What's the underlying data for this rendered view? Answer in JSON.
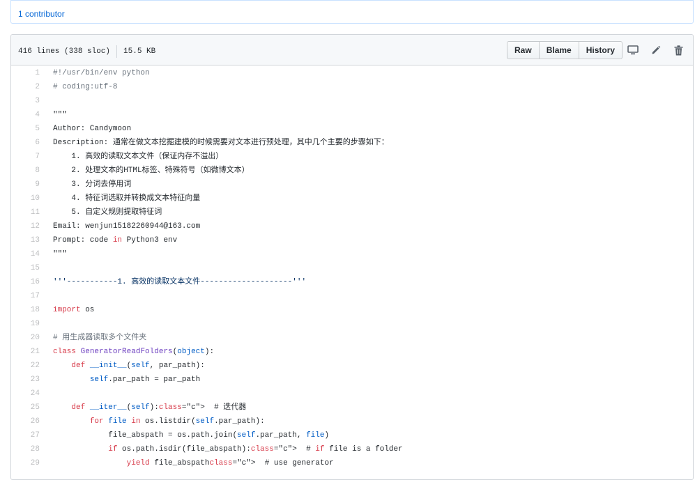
{
  "contributors": {
    "label": "1 contributor"
  },
  "file": {
    "lines": "416 lines (338 sloc)",
    "size": "15.5 KB"
  },
  "buttons": {
    "raw": "Raw",
    "blame": "Blame",
    "history": "History"
  },
  "icons": {
    "desktop": "desktop-icon",
    "edit": "pencil-icon",
    "delete": "trash-icon"
  },
  "code": [
    {
      "n": "1",
      "t": "#!/usr/bin/env python"
    },
    {
      "n": "2",
      "t": "# coding:utf-8"
    },
    {
      "n": "3",
      "t": ""
    },
    {
      "n": "4",
      "t": "\"\"\""
    },
    {
      "n": "5",
      "t": "Author: Candymoon"
    },
    {
      "n": "6",
      "t": "Description: 通常在做文本挖掘建模的时候需要对文本进行预处理，其中几个主要的步骤如下："
    },
    {
      "n": "7",
      "t": "    1. 高效的读取文本文件（保证内存不溢出）"
    },
    {
      "n": "8",
      "t": "    2. 处理文本的HTML标签、特殊符号（如微博文本）"
    },
    {
      "n": "9",
      "t": "    3. 分词去停用词"
    },
    {
      "n": "10",
      "t": "    4. 特征词选取并转换成文本特征向量"
    },
    {
      "n": "11",
      "t": "    5. 自定义规则提取特征词"
    },
    {
      "n": "12",
      "t": "Email: wenjun15182260944@163.com"
    },
    {
      "n": "13",
      "t": "Prompt: code in Python3 env"
    },
    {
      "n": "14",
      "t": "\"\"\""
    },
    {
      "n": "15",
      "t": ""
    },
    {
      "n": "16",
      "t": "'''-----------1. 高效的读取文本文件--------------------'''"
    },
    {
      "n": "17",
      "t": ""
    },
    {
      "n": "18",
      "t": "import os"
    },
    {
      "n": "19",
      "t": ""
    },
    {
      "n": "20",
      "t": "# 用生成器读取多个文件夹"
    },
    {
      "n": "21",
      "t": "class GeneratorReadFolders(object):"
    },
    {
      "n": "22",
      "t": "    def __init__(self, par_path):"
    },
    {
      "n": "23",
      "t": "        self.par_path = par_path"
    },
    {
      "n": "24",
      "t": ""
    },
    {
      "n": "25",
      "t": "    def __iter__(self):  # 迭代器"
    },
    {
      "n": "26",
      "t": "        for file in os.listdir(self.par_path):"
    },
    {
      "n": "27",
      "t": "            file_abspath = os.path.join(self.par_path, file)"
    },
    {
      "n": "28",
      "t": "            if os.path.isdir(file_abspath):  # if file is a folder"
    },
    {
      "n": "29",
      "t": "                yield file_abspath  # use generator"
    }
  ]
}
